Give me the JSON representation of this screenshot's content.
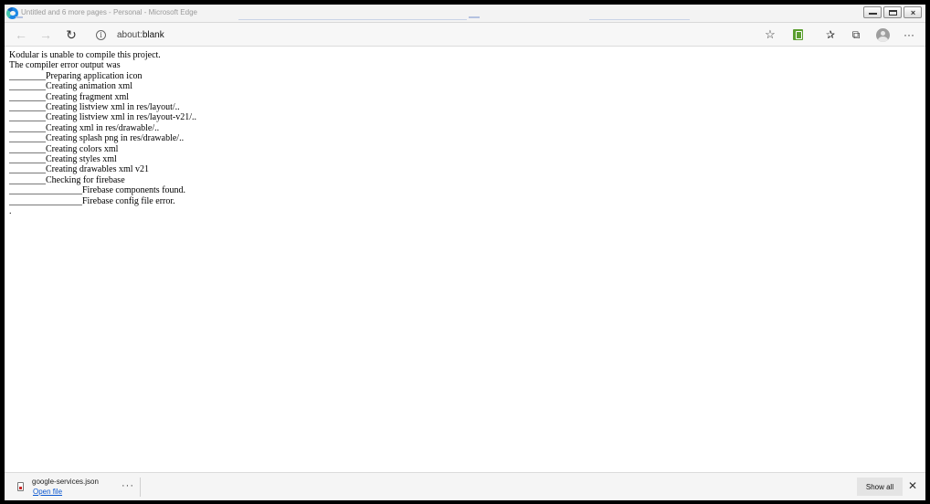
{
  "window": {
    "title": "Untitled and 6 more pages - Personal - Microsoft Edge"
  },
  "toolbar": {
    "address": {
      "prefix": "about:",
      "host": "blank"
    },
    "icons": {
      "back": "back-arrow-icon",
      "forward": "forward-arrow-icon",
      "refresh": "refresh-icon",
      "info": "info-icon",
      "favorite": "star-icon",
      "extension": "extension-icon",
      "favorites": "favorites-list-icon",
      "collections": "collections-icon",
      "profile": "profile-avatar-icon",
      "menu": "more-menu-icon"
    }
  },
  "page": {
    "lines": [
      "Kodular is unable to compile this project.",
      "The compiler error output was",
      "________Preparing application icon",
      "________Creating animation xml",
      "________Creating fragment xml",
      "________Creating listview xml in res/layout/..",
      "________Creating listview xml in res/layout-v21/..",
      "________Creating xml in res/drawable/..",
      "________Creating splash png in res/drawable/..",
      "________Creating colors xml",
      "________Creating styles xml",
      "________Creating drawables xml v21",
      "________Checking for firebase",
      "________________Firebase components found.",
      "________________Firebase config file error.",
      "."
    ]
  },
  "download_bar": {
    "file_name": "google-services.json",
    "open_label": "Open file",
    "more_label": "···",
    "show_all_label": "Show all",
    "close_label": "✕"
  },
  "colors": {
    "link": "#0b57d0",
    "extension_green": "#5a9e2f"
  }
}
